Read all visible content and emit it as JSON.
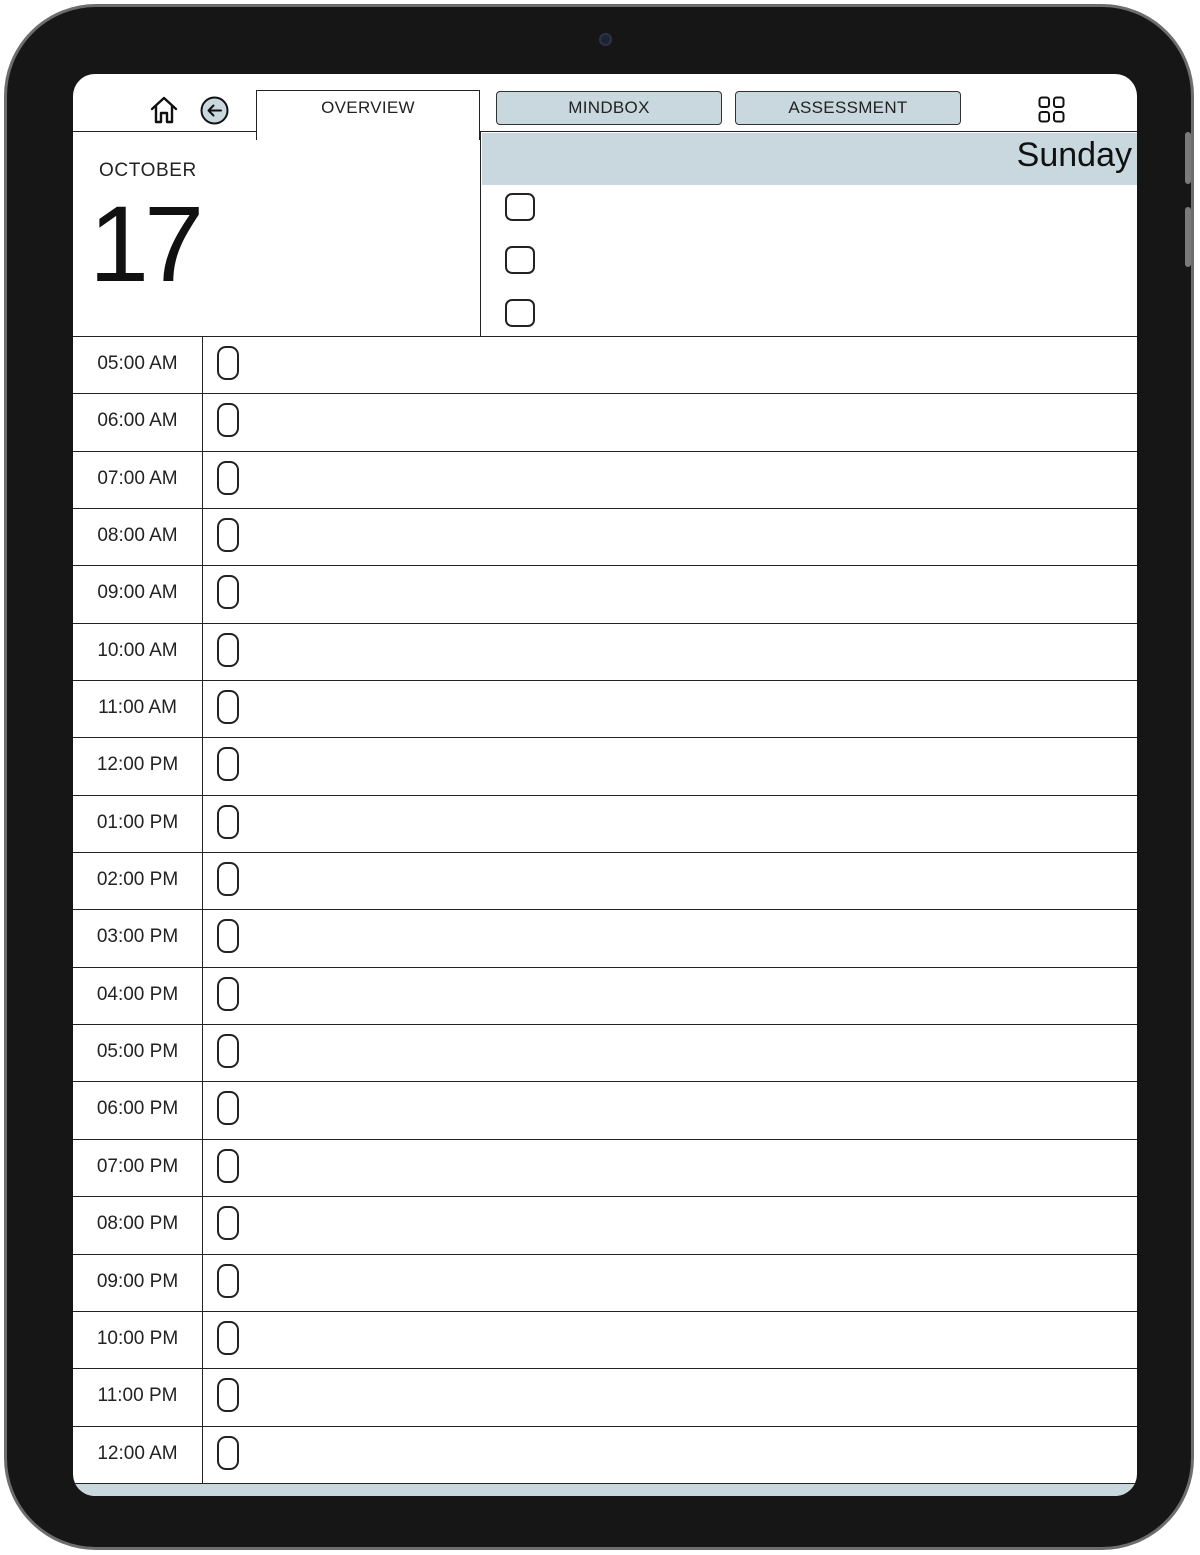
{
  "theme": {
    "accent": "#c9d7df",
    "ink": "#222222",
    "frame": "#161616"
  },
  "toolbar": {
    "home_icon": "home-icon",
    "back_icon": "back-arrow-circle-icon",
    "menu_icon": "grid-icon",
    "tabs": [
      {
        "label": "OVERVIEW",
        "active": true
      },
      {
        "label": "MINDBOX",
        "active": false
      },
      {
        "label": "ASSESSMENT",
        "active": false
      }
    ]
  },
  "date": {
    "month": "OCTOBER",
    "day": "17",
    "weekday": "Sunday"
  },
  "tasks": [
    {
      "checked": false
    },
    {
      "checked": false
    },
    {
      "checked": false
    }
  ],
  "schedule": [
    "05:00 AM",
    "06:00 AM",
    "07:00 AM",
    "08:00 AM",
    "09:00 AM",
    "10:00 AM",
    "11:00 AM",
    "12:00 PM",
    "01:00 PM",
    "02:00 PM",
    "03:00 PM",
    "04:00 PM",
    "05:00 PM",
    "06:00 PM",
    "07:00 PM",
    "08:00 PM",
    "09:00 PM",
    "10:00 PM",
    "11:00 PM",
    "12:00 AM"
  ]
}
